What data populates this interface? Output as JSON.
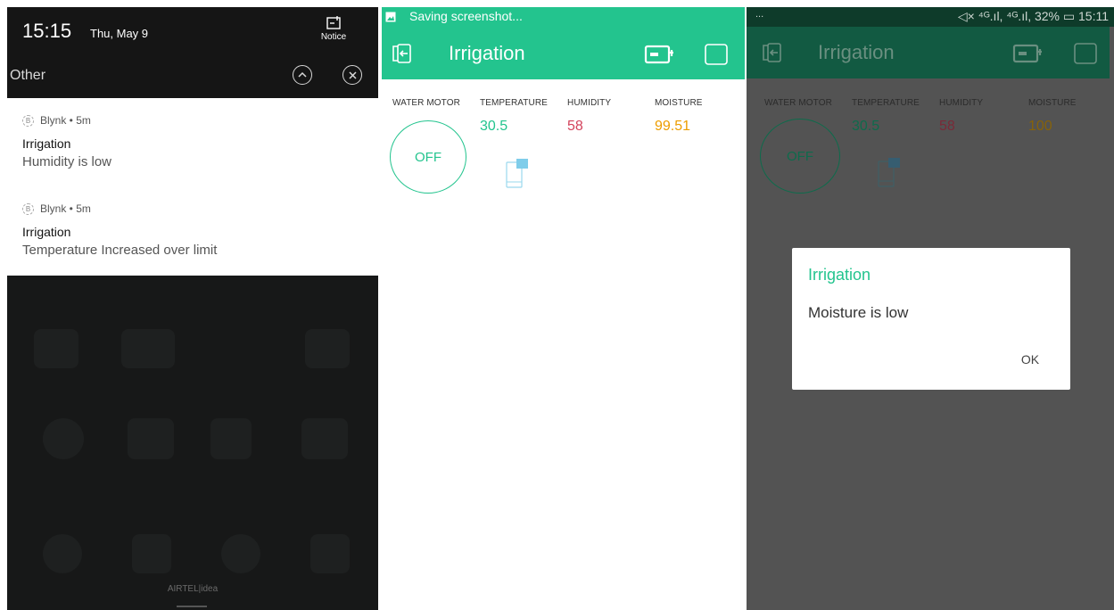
{
  "shade": {
    "time": "15:15",
    "date": "Thu, May 9",
    "notice_label": "Notice",
    "group_label": "Other",
    "notifications": [
      {
        "app": "Blynk",
        "age": "5m",
        "app_icon_letter": "B",
        "title": "Irrigation",
        "body": "Humidity is low"
      },
      {
        "app": "Blynk",
        "age": "5m",
        "app_icon_letter": "B",
        "title": "Irrigation",
        "body": "Temperature Increased over limit"
      }
    ],
    "carrier": "AIRTEL|idea"
  },
  "app": {
    "status_text": "Saving screenshot...",
    "title": "Irrigation",
    "accent": "#23c48e",
    "labels": {
      "motor": "WATER MOTOR",
      "temperature": "TEMPERATURE",
      "humidity": "HUMIDITY",
      "moisture": "MOISTURE"
    },
    "motor_state": "OFF",
    "values": {
      "temperature": "30.5",
      "humidity": "58",
      "moisture": "99.51"
    },
    "colors": {
      "temperature": "#23c48e",
      "humidity": "#d3435c",
      "moisture": "#ed9d00"
    }
  },
  "app_dimmed": {
    "status_dots": "...",
    "status_right": "◁× ⁴ᴳ.ıl, ⁴ᴳ.ıl, 32% ▭ 15:11",
    "title": "Irrigation",
    "motor_state": "OFF",
    "values": {
      "temperature": "30.5",
      "humidity": "58",
      "moisture": "100"
    },
    "colors": {
      "temperature": "#0e6b4c",
      "humidity": "#7a2a38",
      "moisture": "#86620a",
      "motor": "#0e6b4c"
    }
  },
  "dialog": {
    "title": "Irrigation",
    "message": "Moisture is low",
    "ok_label": "OK"
  }
}
